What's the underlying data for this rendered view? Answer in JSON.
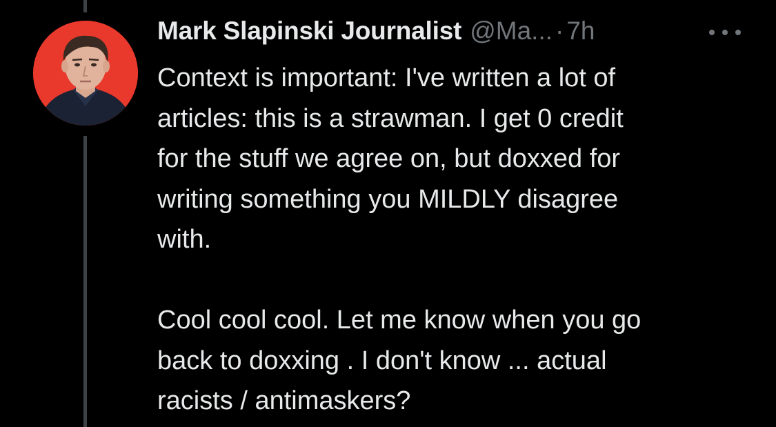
{
  "tweet": {
    "author": {
      "display_name": "Mark Slapinski Journalist",
      "handle": "@Ma...",
      "avatar_icon": "profile-photo",
      "avatar_background": "#e8392c"
    },
    "separator": "·",
    "timestamp": "7h",
    "more_icon": "more-horizontal-icon",
    "text": {
      "paragraph1": [
        "Context is important: I've written a lot of",
        "articles: this is a strawman. I get 0 credit",
        "for the stuff we agree on, but doxxed for",
        "writing something you MILDLY disagree",
        "with."
      ],
      "paragraph2": [
        "Cool cool cool. Let me know when you go",
        "back to doxxing . I don't know ... actual",
        "racists / antimaskers?"
      ]
    }
  },
  "colors": {
    "background": "#000000",
    "text_primary": "#e7e9ea",
    "text_secondary": "#71767b",
    "thread_line": "#3d4247"
  }
}
